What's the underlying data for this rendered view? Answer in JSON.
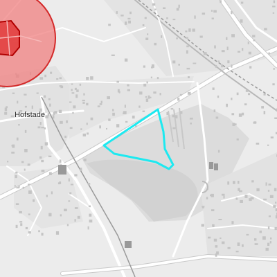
{
  "map": {
    "place_labels": [
      {
        "name": "Hofstade"
      }
    ],
    "colors": {
      "background": "#ececec",
      "industrial_area": "#d9d9d9",
      "road_major": "#ffffff",
      "road_casing": "#c9c9c9",
      "railway": "#9a9a9a",
      "building": "#c4c4c4",
      "radius_outer_fill": "#f08080",
      "radius_inner_fill": "#e03030",
      "highlight_outline": "#1de9f0"
    },
    "overlays": [
      {
        "type": "radius-circle-outer",
        "fill": "#f08080",
        "stroke": "#d42a2a"
      },
      {
        "type": "radius-circle-inner",
        "fill": "#e23b3b",
        "stroke": "#b00000"
      },
      {
        "type": "highlight-polygon",
        "stroke": "#1de9f0"
      }
    ]
  }
}
